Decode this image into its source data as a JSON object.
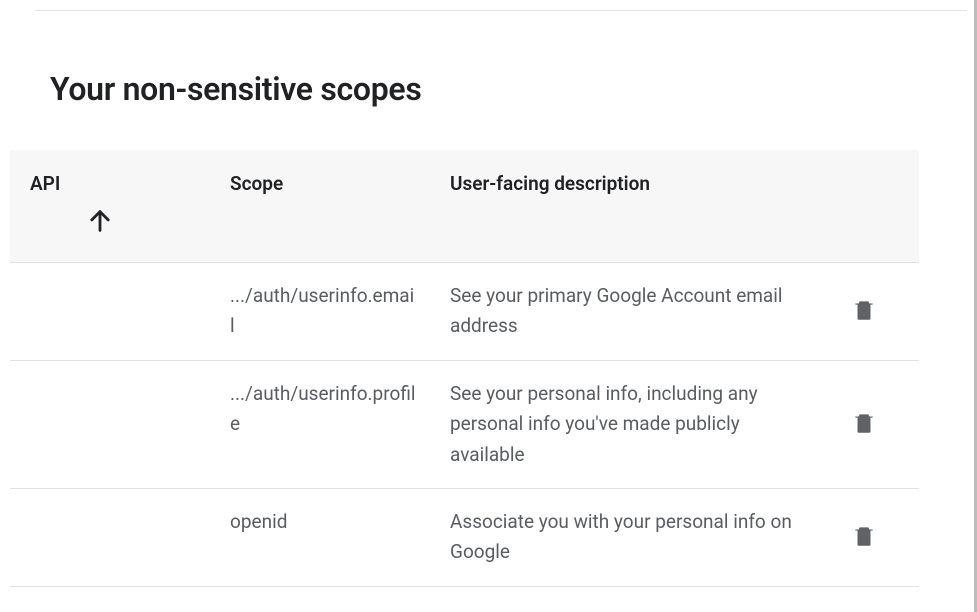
{
  "title": "Your non-sensitive scopes",
  "columns": {
    "api": "API",
    "scope": "Scope",
    "desc": "User-facing description"
  },
  "rows": [
    {
      "api": "",
      "scope": ".../auth/userinfo.email",
      "desc": "See your primary Google Account email address"
    },
    {
      "api": "",
      "scope": ".../auth/userinfo.profile",
      "desc": "See your personal info, including any personal info you've made publicly available"
    },
    {
      "api": "",
      "scope": "openid",
      "desc": "Associate you with your personal info on Google"
    }
  ]
}
